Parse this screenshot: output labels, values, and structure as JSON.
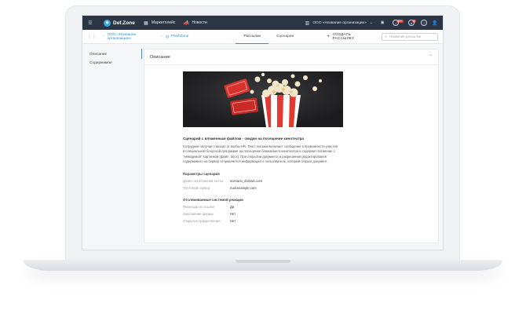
{
  "topbar": {
    "logo_text": "Def.Zone",
    "menu_marketplace": "Маркетплейс",
    "menu_news": "Новости",
    "org_name": "ООО «Название организации»",
    "badge_notifications": "99+",
    "badge_messages": "5"
  },
  "subbar": {
    "breadcrumb_org": "ООО «Название организации»",
    "breadcrumb_current": "PhishZone",
    "tabs": [
      {
        "label": "Рассылки"
      },
      {
        "label": "Сценарии"
      }
    ],
    "create_label": "СОЗДАТЬ РАССЫЛКУ",
    "search_placeholder": "Название рассылки"
  },
  "sidebar": {
    "items": [
      {
        "label": "Описание"
      },
      {
        "label": "Содержимое"
      }
    ]
  },
  "card": {
    "header": "Описание",
    "scenario_title": "Сценарий с вложенным файлом - скидки на посещение кинотеатра",
    "description": "Сотрудник получает письмо от якобы HR. Текст письма включает сообщение о возможности участия в специальной бонусной программе на посещение ближайшего кинотеатра и содержит вложение с \"невидимой\" картинкой (файл .docx). При открытии документа и разрешении редактирования содержимого на сервер отправляется информация о пользователе, который открыл документ.",
    "params_title": "Параметры сценария",
    "params": [
      {
        "key": "Домен электронной почты",
        "value": "scenario_domain.com"
      },
      {
        "key": "Почтовый сервер",
        "value": "mail.example.com"
      }
    ],
    "tracked_title": "Отслеживаемые системой реакции",
    "tracked": [
      {
        "key": "Переходы по ссылке",
        "value": "Да"
      },
      {
        "key": "Заполнение формы",
        "value": "Нет"
      },
      {
        "key": "Открытие прикрепления",
        "value": "Нет"
      }
    ]
  },
  "colors": {
    "topbar_bg": "#2b3544",
    "accent": "#2f8fd6",
    "badge_red": "#e2413a"
  }
}
